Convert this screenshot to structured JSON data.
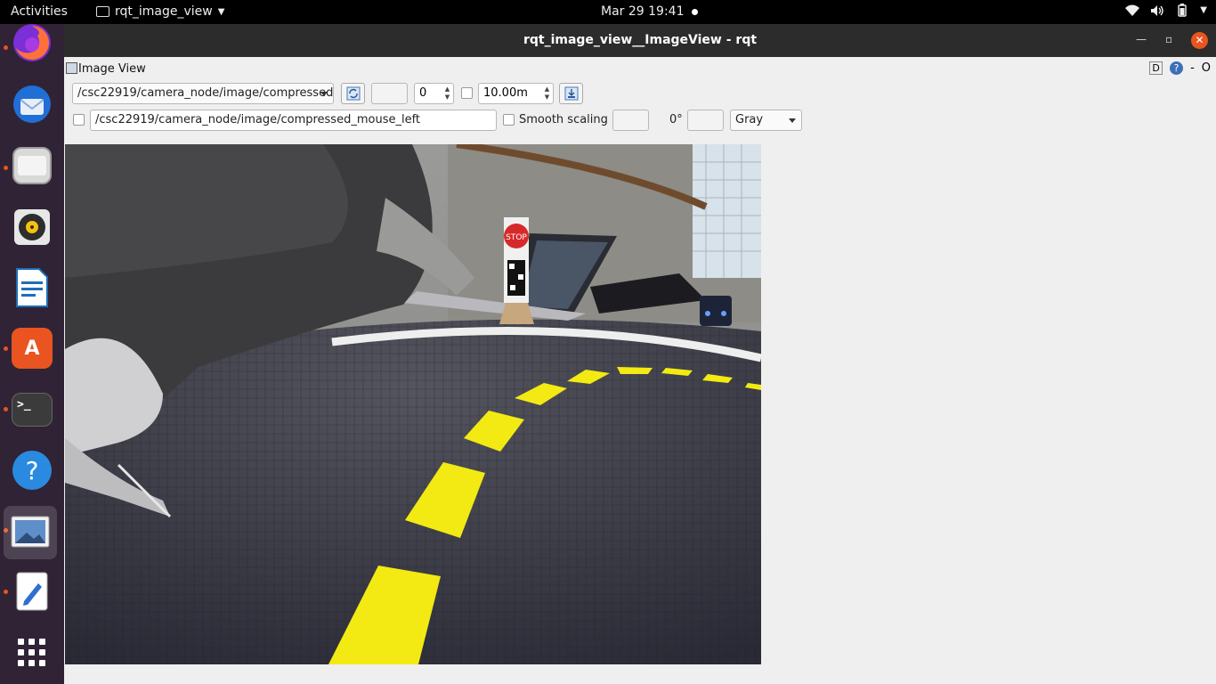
{
  "topbar": {
    "activities": "Activities",
    "app_name": "rqt_image_view",
    "clock": "Mar 29  19:41"
  },
  "window": {
    "title": "rqt_image_view__ImageView - rqt"
  },
  "plugin": {
    "title": "Image View",
    "d_label": "D",
    "q_label": "?",
    "dash": "-",
    "o_label": "O"
  },
  "toolbar": {
    "topic": "/csc22919/camera_node/image/compressed",
    "spin_value": "0",
    "max_range": "10.00m",
    "mouse_topic": "/csc22919/camera_node/image/compressed_mouse_left",
    "smooth_scaling": "Smooth scaling",
    "rotation": "0°",
    "colormap": "Gray"
  },
  "image": {
    "sign_text": "STOP"
  },
  "dock": {
    "items": [
      "firefox-icon",
      "thunderbird-icon",
      "files-icon",
      "rhythmbox-icon",
      "writer-icon",
      "software-icon",
      "terminal-icon",
      "help-icon",
      "image-viewer-icon",
      "text-editor-icon",
      "app-grid-icon"
    ],
    "terminal_glyph": ">_",
    "help_glyph": "?"
  }
}
